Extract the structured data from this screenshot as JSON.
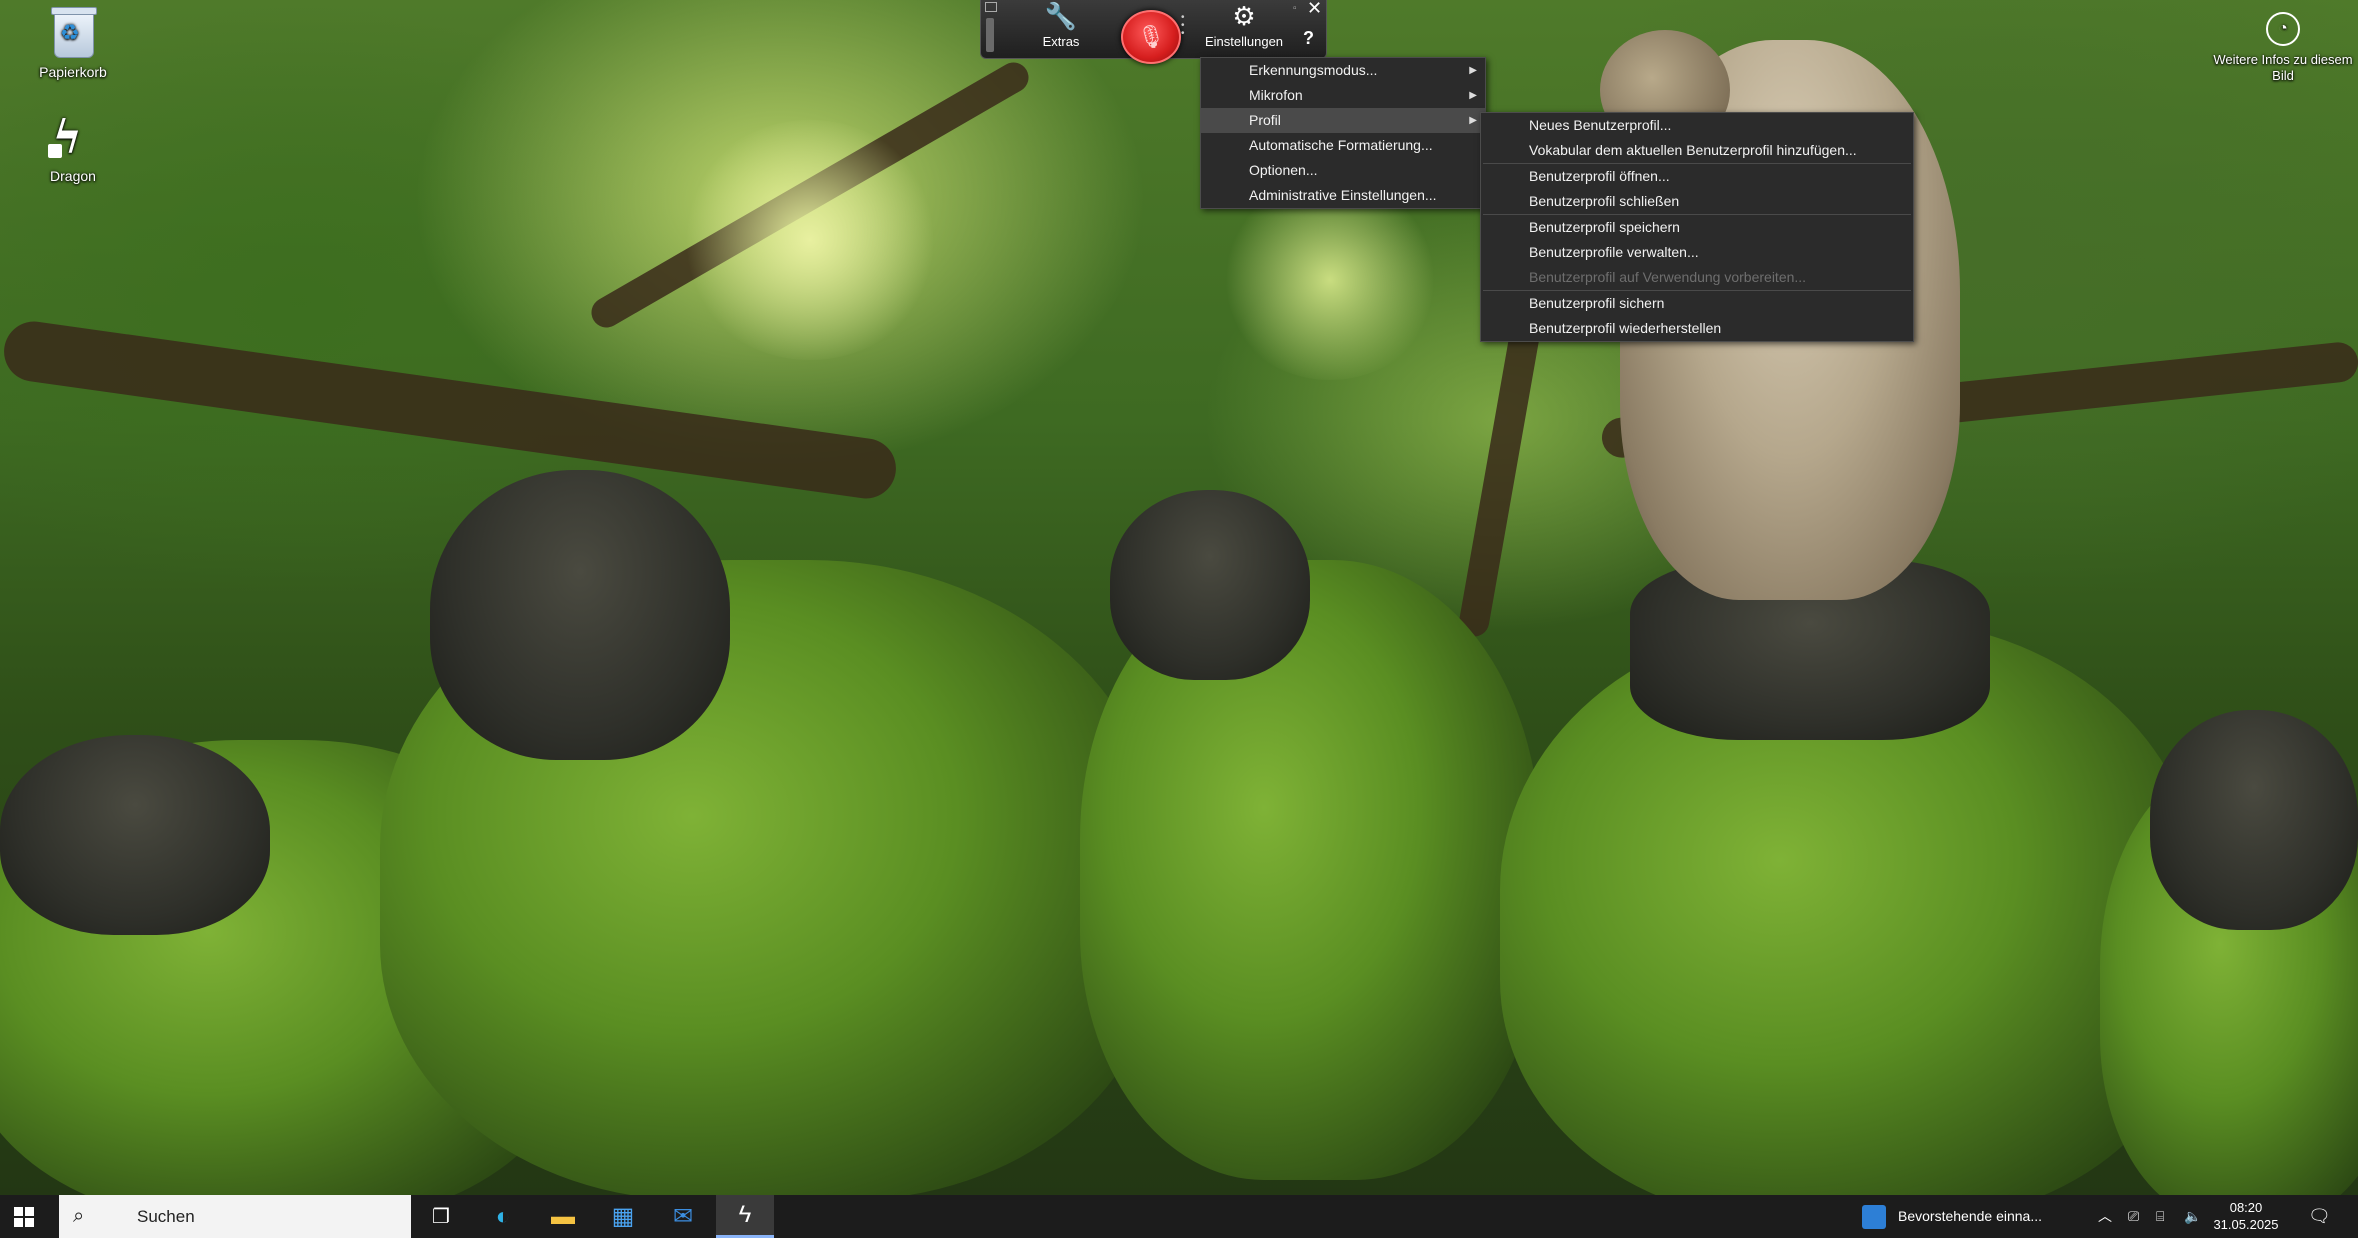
{
  "desktop": {
    "icons": [
      {
        "label": "Papierkorb",
        "icon": "recycle-bin-icon"
      },
      {
        "label": "Dragon",
        "icon": "dragon-icon"
      }
    ],
    "info": {
      "label": "Weitere Infos zu diesem Bild",
      "icon": "camera-info-icon"
    }
  },
  "toolbar": {
    "extras_label": "Extras",
    "settings_label": "Einstellungen",
    "help_label": "?",
    "close_label": "✕",
    "mic_state": "off",
    "mic_color": "#d61e1e"
  },
  "main_menu": {
    "items": [
      {
        "label": "Erkennungsmodus...",
        "submenu": true
      },
      {
        "label": "Mikrofon",
        "submenu": true
      },
      {
        "label": "Profil",
        "submenu": true,
        "active": true
      },
      {
        "label": "Automatische Formatierung...",
        "submenu": false
      },
      {
        "label": "Optionen...",
        "submenu": false
      },
      {
        "label": "Administrative Einstellungen...",
        "submenu": false
      }
    ]
  },
  "profile_menu": {
    "items": [
      {
        "label": "Neues Benutzerprofil...",
        "enabled": true
      },
      {
        "label": "Vokabular dem aktuellen Benutzerprofil hinzufügen...",
        "enabled": true
      },
      {
        "label": "Benutzerprofil öffnen...",
        "enabled": true
      },
      {
        "label": "Benutzerprofil schließen",
        "enabled": true
      },
      {
        "label": "Benutzerprofil speichern",
        "enabled": true
      },
      {
        "label": "Benutzerprofile verwalten...",
        "enabled": true
      },
      {
        "label": "Benutzerprofil auf Verwendung vorbereiten...",
        "enabled": false
      },
      {
        "label": "Benutzerprofil sichern",
        "enabled": true
      },
      {
        "label": "Benutzerprofil wiederherstellen",
        "enabled": true
      }
    ]
  },
  "taskbar": {
    "search_placeholder": "Suchen",
    "news_text": "Bevorstehende einna...",
    "time": "08:20",
    "date": "31.05.2025",
    "apps": [
      "task-view-icon",
      "edge-icon",
      "file-explorer-icon",
      "store-icon",
      "mail-icon",
      "dragon-icon"
    ]
  }
}
